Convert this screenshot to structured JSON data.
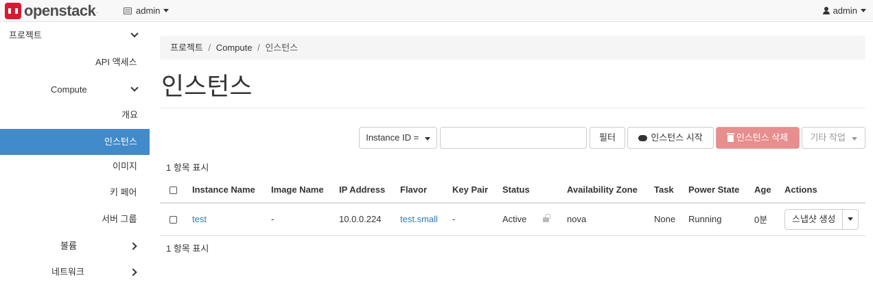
{
  "brand": {
    "name": "openstack"
  },
  "topbar": {
    "project": "admin",
    "user": "admin"
  },
  "sidebar": {
    "items": [
      {
        "label": "프로젝트"
      },
      {
        "label": "API 액세스"
      },
      {
        "label": "Compute"
      },
      {
        "label": "개요"
      },
      {
        "label": "인스턴스"
      },
      {
        "label": "이미지"
      },
      {
        "label": "키 페어"
      },
      {
        "label": "서버 그룹"
      },
      {
        "label": "볼륨"
      },
      {
        "label": "네트워크"
      }
    ]
  },
  "breadcrumb": {
    "root": "프로젝트",
    "section": "Compute",
    "current": "인스턴스",
    "sep": "/"
  },
  "page": {
    "title": "인스턴스"
  },
  "toolbar": {
    "filter_field": "Instance ID =",
    "filter_value": "",
    "filter_button": "필터",
    "launch_button": "인스턴스 시작",
    "delete_button": "인스턴스 삭제",
    "more_button": "기타 작업"
  },
  "table": {
    "count_text": "1 항목 표시",
    "columns": [
      "Instance Name",
      "Image Name",
      "IP Address",
      "Flavor",
      "Key Pair",
      "Status",
      "Availability Zone",
      "Task",
      "Power State",
      "Age",
      "Actions"
    ],
    "rows": [
      {
        "name": "test",
        "image": "-",
        "ip": "10.0.0.224",
        "flavor": "test.small",
        "keypair": "-",
        "status": "Active",
        "zone": "nova",
        "task": "None",
        "power": "Running",
        "age": "0분",
        "action": "스냅샷 생성"
      }
    ]
  }
}
